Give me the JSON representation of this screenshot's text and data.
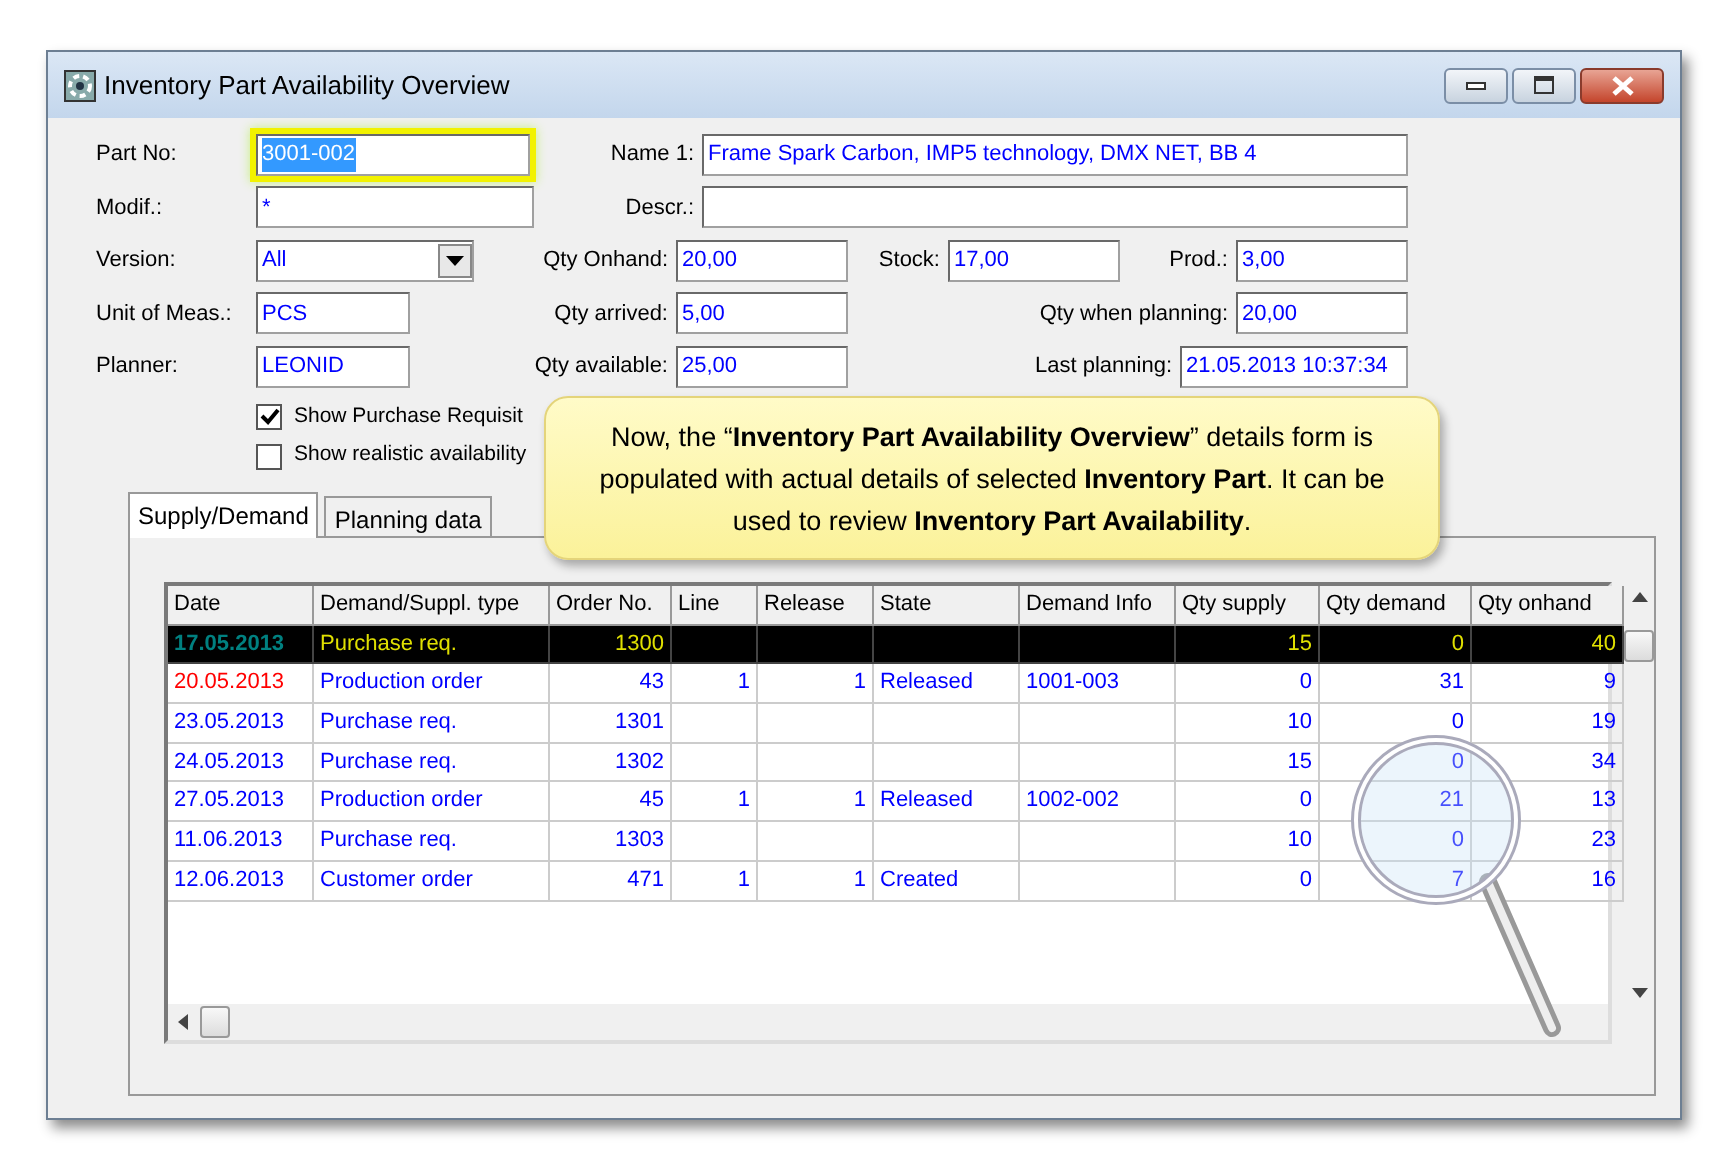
{
  "window": {
    "title": "Inventory Part Availability Overview"
  },
  "form": {
    "rows": [
      [
        {
          "label": "Part No:",
          "value": "3001-002",
          "kind": "text",
          "highlighted": true
        },
        {
          "label": "Name 1:",
          "value": "Frame Spark Carbon, IMP5 technology, DMX NET, BB 4",
          "kind": "text",
          "highlighted": false
        }
      ],
      [
        {
          "label": "Modif.:",
          "value": "*",
          "kind": "text",
          "highlighted": false
        },
        {
          "label": "Descr.:",
          "kind": "text",
          "highlighted": false
        }
      ],
      [
        {
          "label": "Version:",
          "value": "All",
          "kind": "combo",
          "highlighted": false
        },
        {
          "label": "Qty Onhand:",
          "value": "20,00",
          "kind": "text",
          "highlighted": false
        },
        {
          "label": "Stock:",
          "value": "17,00",
          "kind": "text",
          "highlighted": false
        },
        {
          "label": "Prod.:",
          "value": "3,00",
          "kind": "text",
          "highlighted": false
        }
      ],
      [
        {
          "label": "Unit of Meas.:",
          "value": "PCS",
          "kind": "text",
          "highlighted": false
        },
        {
          "label": "Qty arrived:",
          "value": "5,00",
          "kind": "text",
          "highlighted": false
        },
        {
          "label": "Qty when planning:",
          "value": "20,00",
          "kind": "text",
          "highlighted": false
        }
      ],
      [
        {
          "label": "Planner:",
          "value": "LEONID",
          "kind": "text",
          "highlighted": false
        },
        {
          "label": "Qty available:",
          "value": "25,00",
          "kind": "text",
          "highlighted": false
        },
        {
          "label": "Last planning:",
          "value": "21.05.2013 10:37:34",
          "kind": "text",
          "highlighted": false
        }
      ]
    ],
    "checkboxes": [
      {
        "label": "Show Purchase Requisit",
        "checked": true
      },
      {
        "label": "Show realistic availability",
        "checked": false
      }
    ]
  },
  "tabs": [
    {
      "label": "Supply/Demand",
      "selected": true
    },
    {
      "label": "Planning data",
      "selected": false
    }
  ],
  "table": {
    "columns": [
      "Date",
      "Demand/Suppl. type",
      "Order No.",
      "Line",
      "Release",
      "State",
      "Demand Info",
      "Qty supply",
      "Qty demand",
      "Qty onhand"
    ],
    "rows": [
      {
        "selected": true,
        "color": "#008080",
        "cells": [
          "17.05.2013",
          "Purchase req.",
          "1300",
          "",
          "",
          "",
          "",
          "15",
          "0",
          "40"
        ]
      },
      {
        "selected": false,
        "color": "#ff0000",
        "cells": [
          "20.05.2013",
          "Production order",
          "43",
          "1",
          "1",
          "Released",
          "1001-003",
          "0",
          "31",
          "9"
        ]
      },
      {
        "selected": false,
        "color": "#0000ff",
        "cells": [
          "23.05.2013",
          "Purchase req.",
          "1301",
          "",
          "",
          "",
          "",
          "10",
          "0",
          "19"
        ]
      },
      {
        "selected": false,
        "color": "#0000ff",
        "cells": [
          "24.05.2013",
          "Purchase req.",
          "1302",
          "",
          "",
          "",
          "",
          "15",
          "0",
          "34"
        ]
      },
      {
        "selected": false,
        "color": "#0000ff",
        "cells": [
          "27.05.2013",
          "Production order",
          "45",
          "1",
          "1",
          "Released",
          "1002-002",
          "0",
          "21",
          "13"
        ]
      },
      {
        "selected": false,
        "color": "#0000ff",
        "cells": [
          "11.06.2013",
          "Purchase req.",
          "1303",
          "",
          "",
          "",
          "",
          "10",
          "0",
          "23"
        ]
      },
      {
        "selected": false,
        "color": "#0000ff",
        "cells": [
          "12.06.2013",
          "Customer order",
          "471",
          "1",
          "1",
          "Created",
          "",
          "0",
          "7",
          "16"
        ]
      }
    ]
  },
  "callout": {
    "text": "Now, the “**Inventory Part Availability Overview**” details form is populated with actual details of selected **Inventory Part**.  It can be used to review **Inventory Part Availability**."
  }
}
